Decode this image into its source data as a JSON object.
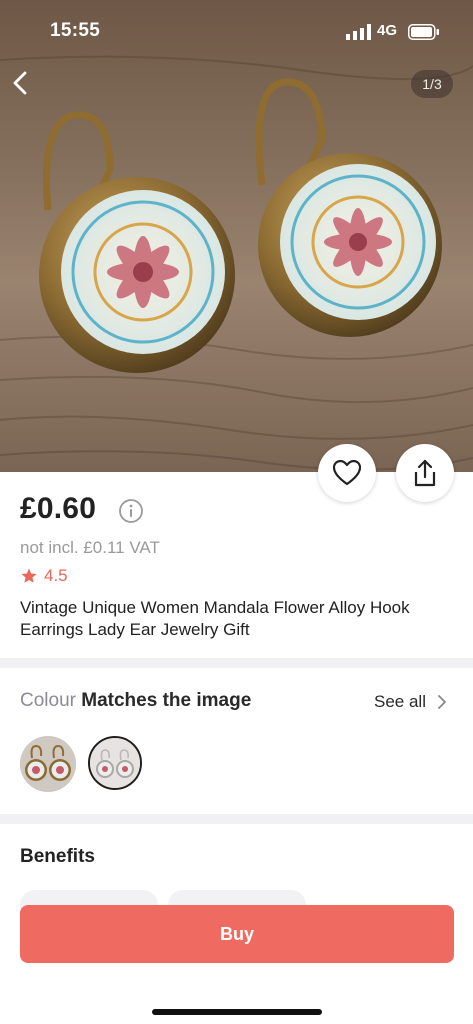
{
  "status_bar": {
    "time": "15:55",
    "network": "4G"
  },
  "gallery": {
    "counter": "1/3"
  },
  "product": {
    "price": "£0.60",
    "vat_note": "not incl. £0.11 VAT",
    "rating": "4.5",
    "title": "Vintage Unique Women Mandala Flower Alloy Hook Earrings Lady Ear Jewelry Gift"
  },
  "colour": {
    "label": "Colour",
    "value": "Matches the image",
    "see_all": "See all",
    "selected_index": 1
  },
  "benefits": {
    "heading": "Benefits"
  },
  "actions": {
    "buy_label": "Buy"
  },
  "colors": {
    "accent": "#ef6b62",
    "rating": "#e8685a"
  },
  "icons": [
    "back-icon",
    "heart-icon",
    "share-icon",
    "info-icon",
    "star-icon",
    "chevron-right-icon"
  ]
}
